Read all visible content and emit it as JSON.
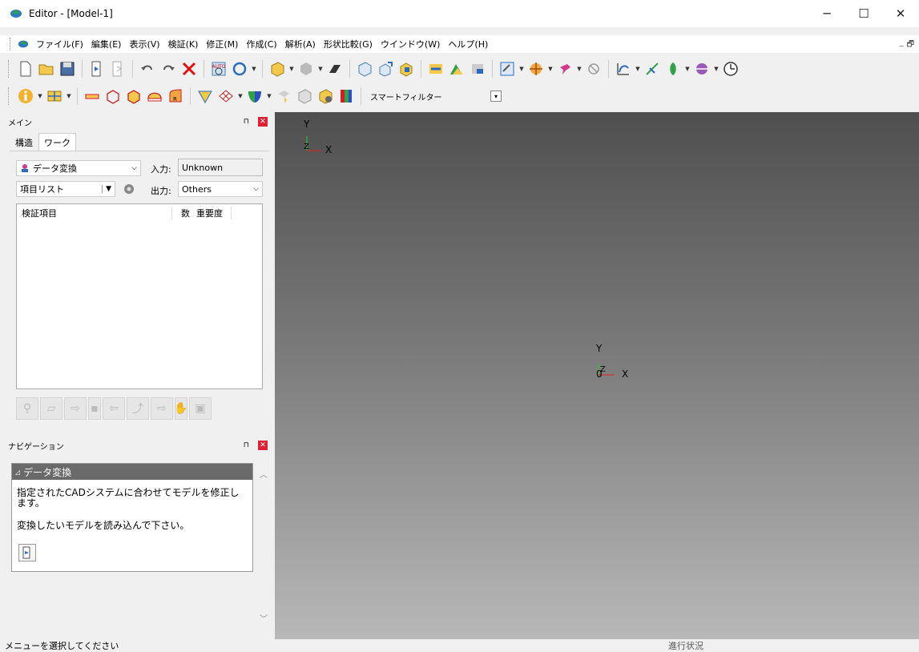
{
  "window": {
    "title": "Editor - [Model-1]",
    "minimize": "─",
    "maximize": "☐",
    "close": "✕"
  },
  "menu": {
    "items": [
      "ファイル(F)",
      "編集(E)",
      "表示(V)",
      "検証(K)",
      "修正(M)",
      "作成(C)",
      "解析(A)",
      "形状比較(G)",
      "ウインドウ(W)",
      "ヘルプ(H)"
    ],
    "mdi_min": "_",
    "mdi_restore": "🗗"
  },
  "toolbar": {
    "smart_filter": "スマートフィルター"
  },
  "main_panel": {
    "title": "メイン",
    "pin": "⊓",
    "tabs": [
      "構造",
      "ワーク"
    ],
    "work_dropdown": "データ変換",
    "input_label": "入力:",
    "input_value": "Unknown",
    "item_list_dropdown": "項目リスト",
    "output_label": "出力:",
    "output_value": "Others",
    "list_headers": {
      "item": "検証項目",
      "count": "数",
      "severity": "重要度"
    }
  },
  "nav_panel": {
    "title": "ナビゲーション",
    "section_title": "データ変換",
    "description": "指定されたCADシステムに合わせてモデルを修正します。",
    "instruction": "変換したいモデルを読み込んで下さい。"
  },
  "viewport": {
    "axis_x": "X",
    "axis_y": "Y",
    "axis_z": "Z",
    "origin": "0"
  },
  "status": {
    "message": "メニューを選択してください",
    "progress_label": "進行状況"
  }
}
